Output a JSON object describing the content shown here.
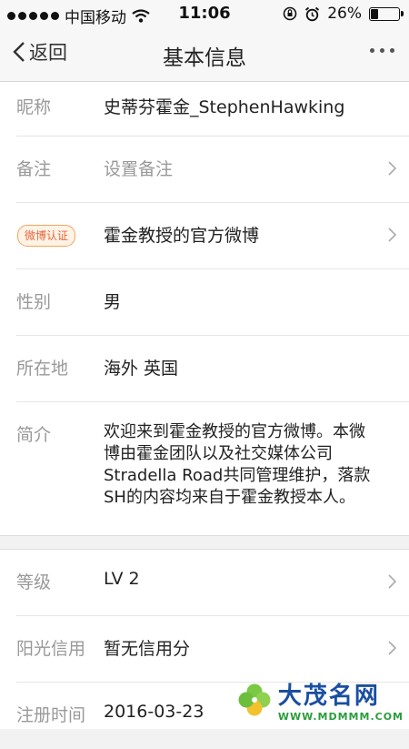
{
  "status_bar": {
    "carrier": "中国移动",
    "time": "11:06",
    "battery": "26%",
    "battery_level": 0.26
  },
  "nav": {
    "back_label": "返回",
    "title": "基本信息"
  },
  "profile": {
    "nickname": {
      "label": "昵称",
      "value": "史蒂芬霍金_StephenHawking"
    },
    "remark": {
      "label": "备注",
      "value": "设置备注"
    },
    "verification": {
      "badge": "微博认证",
      "value": "霍金教授的官方微博"
    },
    "gender": {
      "label": "性别",
      "value": "男"
    },
    "location": {
      "label": "所在地",
      "value": "海外 英国"
    },
    "intro": {
      "label": "简介",
      "value": "欢迎来到霍金教授的官方微博。本微博由霍金团队以及社交媒体公司Stradella Road共同管理维护，落款SH的内容均来自于霍金教授本人。"
    }
  },
  "account": {
    "level": {
      "label": "等级",
      "value": "LV 2"
    },
    "credit": {
      "label": "阳光信用",
      "value": "暂无信用分"
    },
    "register": {
      "label": "注册时间",
      "value": "2016-03-23"
    }
  },
  "watermark": {
    "brand": "大茂名网",
    "site": "WWW.MDMMM.COM"
  }
}
